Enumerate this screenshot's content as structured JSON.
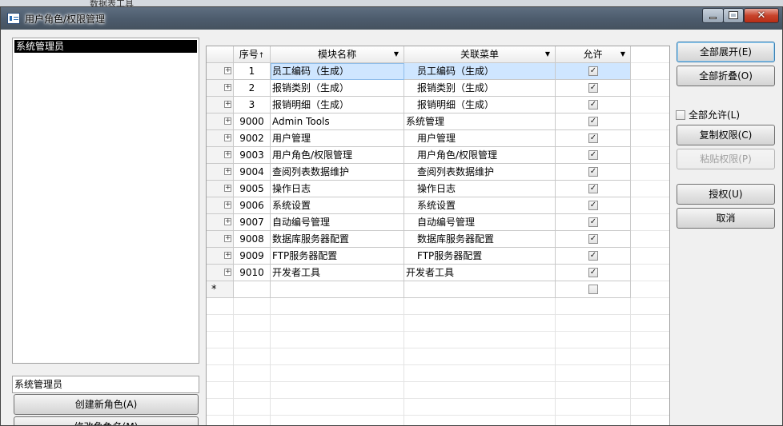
{
  "background_window": {
    "menu_items": [
      "数据表工具"
    ]
  },
  "window": {
    "title": "用户角色/权限管理",
    "controls": {
      "minimize": "",
      "maximize": "",
      "close": "✕"
    }
  },
  "roles": {
    "items": [
      "系统管理员"
    ],
    "current_name": "系统管理员",
    "create_button": "创建新角色(A)",
    "rename_button": "修改角色名(M)"
  },
  "grid": {
    "columns": {
      "no": "序号",
      "name": "模块名称",
      "menu": "关联菜单",
      "allow": "允许"
    },
    "rows": [
      {
        "no": "1",
        "name": "员工编码（生成）",
        "menu": "员工编码（生成）",
        "allow": true,
        "indent": true
      },
      {
        "no": "2",
        "name": "报销类别（生成）",
        "menu": "报销类别（生成）",
        "allow": true,
        "indent": true
      },
      {
        "no": "3",
        "name": "报销明细（生成）",
        "menu": "报销明细（生成）",
        "allow": true,
        "indent": true
      },
      {
        "no": "9000",
        "name": "Admin Tools",
        "menu": "系统管理",
        "allow": true,
        "indent": false
      },
      {
        "no": "9002",
        "name": "用户管理",
        "menu": "用户管理",
        "allow": true,
        "indent": true
      },
      {
        "no": "9003",
        "name": "用户角色/权限管理",
        "menu": "用户角色/权限管理",
        "allow": true,
        "indent": true
      },
      {
        "no": "9004",
        "name": "查阅列表数据维护",
        "menu": "查阅列表数据维护",
        "allow": true,
        "indent": true
      },
      {
        "no": "9005",
        "name": "操作日志",
        "menu": "操作日志",
        "allow": true,
        "indent": true
      },
      {
        "no": "9006",
        "name": "系统设置",
        "menu": "系统设置",
        "allow": true,
        "indent": true
      },
      {
        "no": "9007",
        "name": "自动编号管理",
        "menu": "自动编号管理",
        "allow": true,
        "indent": true
      },
      {
        "no": "9008",
        "name": "数据库服务器配置",
        "menu": "数据库服务器配置",
        "allow": true,
        "indent": true
      },
      {
        "no": "9009",
        "name": "FTP服务器配置",
        "menu": "FTP服务器配置",
        "allow": true,
        "indent": true
      },
      {
        "no": "9010",
        "name": "开发者工具",
        "menu": "开发者工具",
        "allow": true,
        "indent": false
      }
    ],
    "new_row_marker": "*"
  },
  "actions": {
    "expand_all": "全部展开(E)",
    "collapse_all": "全部折叠(O)",
    "allow_all": "全部允许(L)",
    "copy_perm": "复制权限(C)",
    "paste_perm": "粘贴权限(P)",
    "authorize": "授权(U)",
    "cancel": "取消"
  }
}
